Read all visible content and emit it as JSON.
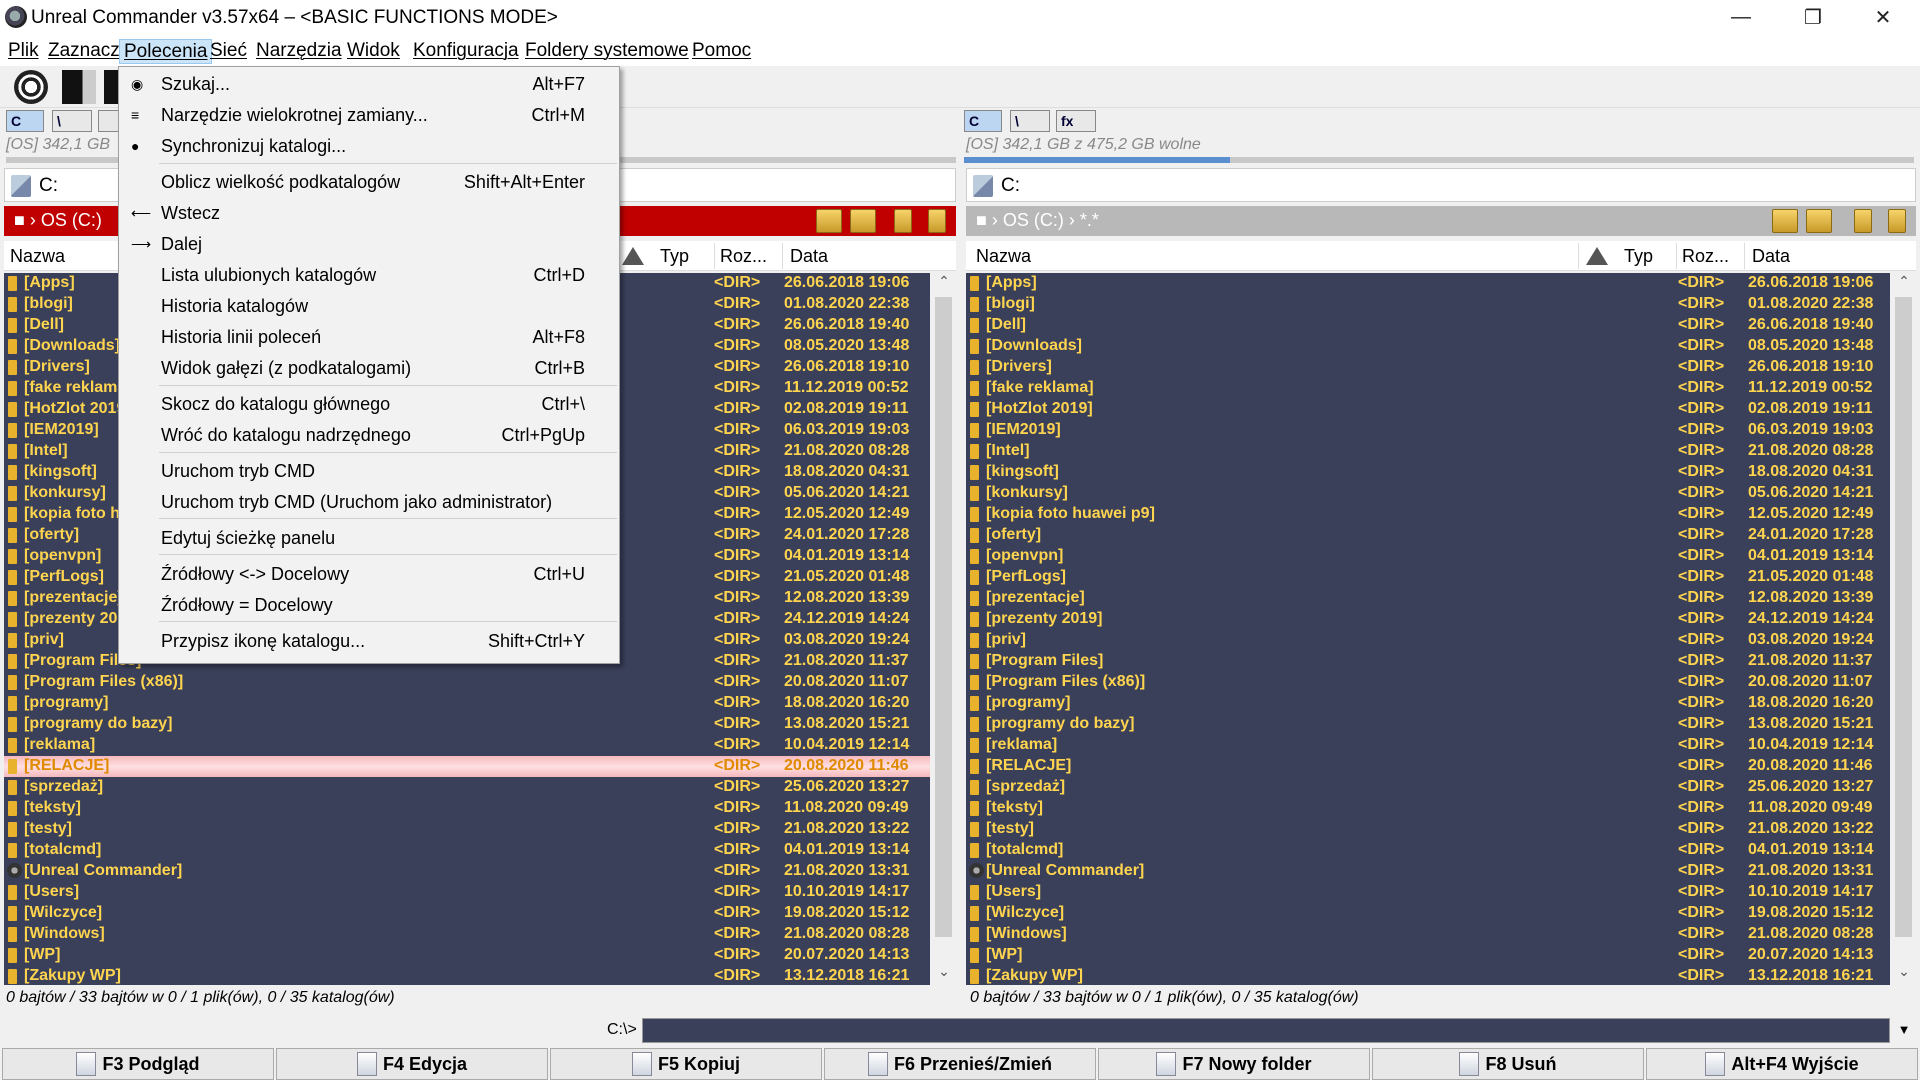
{
  "window": {
    "title": "Unreal Commander v3.57x64 – <BASIC FUNCTIONS MODE>"
  },
  "menubar": [
    {
      "label": "Plik"
    },
    {
      "label": "Zaznacz"
    },
    {
      "label": "Polecenia"
    },
    {
      "label": "Sieć"
    },
    {
      "label": "Narzędzia"
    },
    {
      "label": "Widok"
    },
    {
      "label": "Konfiguracja"
    },
    {
      "label": "Foldery systemowe"
    },
    {
      "label": "Pomoc"
    }
  ],
  "dropdown": [
    {
      "label": "Szukaj...",
      "shortcut": "Alt+F7",
      "icon": "search-icon"
    },
    {
      "label": "Narzędzie wielokrotnej zamiany...",
      "shortcut": "Ctrl+M",
      "icon": "rename-icon"
    },
    {
      "label": "Synchronizuj katalogi...",
      "shortcut": "",
      "icon": "sync-icon"
    },
    {
      "label": "Oblicz wielkość podkatalogów",
      "shortcut": "Shift+Alt+Enter"
    },
    {
      "label": "Wstecz",
      "shortcut": "",
      "icon": "back-arrow-icon"
    },
    {
      "label": "Dalej",
      "shortcut": "",
      "icon": "forward-arrow-icon"
    },
    {
      "label": "Lista ulubionych katalogów",
      "shortcut": "Ctrl+D"
    },
    {
      "label": "Historia katalogów",
      "shortcut": ""
    },
    {
      "label": "Historia linii poleceń",
      "shortcut": "Alt+F8"
    },
    {
      "label": "Widok gałęzi (z podkatalogami)",
      "shortcut": "Ctrl+B"
    },
    {
      "label": "Skocz do katalogu głównego",
      "shortcut": "Ctrl+\\"
    },
    {
      "label": "Wróć do katalogu nadrzędnego",
      "shortcut": "Ctrl+PgUp"
    },
    {
      "label": "Uruchom tryb CMD",
      "shortcut": ""
    },
    {
      "label": "Uruchom tryb CMD (Uruchom jako administrator)",
      "shortcut": ""
    },
    {
      "label": "Edytuj ścieżkę panelu",
      "shortcut": ""
    },
    {
      "label": "Źródłowy <-> Docelowy",
      "shortcut": "Ctrl+U"
    },
    {
      "label": "Źródłowy = Docelowy",
      "shortcut": ""
    },
    {
      "label": "Przypisz ikonę katalogu...",
      "shortcut": "Shift+Ctrl+Y"
    }
  ],
  "left_panel": {
    "drive_info": "[OS]  342,1 GB",
    "path": "C:",
    "breadcrumb": "OS (C:)",
    "status": "0 bajtów / 33 bajtów w 0 / 1 plik(ów), 0 / 35 katalog(ów)"
  },
  "right_panel": {
    "drive_info": "[OS]  342,1 GB z 475,2 GB wolne",
    "path": "C:",
    "breadcrumb": "OS (C:) › *.*",
    "status": "0 bajtów / 33 bajtów w 0 / 1 plik(ów), 0 / 35 katalog(ów)",
    "free_fraction": 0.28
  },
  "drives": {
    "c": "C",
    "net": "\\",
    "fx": "fx"
  },
  "columns": {
    "name": "Nazwa",
    "type": "Typ",
    "size": "Roz...",
    "date": "Data"
  },
  "files": [
    {
      "name": "[Apps]",
      "type": "<DIR>",
      "date": "26.06.2018 19:06"
    },
    {
      "name": "[blogi]",
      "type": "<DIR>",
      "date": "01.08.2020 22:38"
    },
    {
      "name": "[Dell]",
      "type": "<DIR>",
      "date": "26.06.2018 19:40"
    },
    {
      "name": "[Downloads]",
      "type": "<DIR>",
      "date": "08.05.2020 13:48"
    },
    {
      "name": "[Drivers]",
      "type": "<DIR>",
      "date": "26.06.2018 19:10"
    },
    {
      "name": "[fake reklama]",
      "type": "<DIR>",
      "date": "11.12.2019 00:52"
    },
    {
      "name": "[HotZlot 2019]",
      "type": "<DIR>",
      "date": "02.08.2019 19:11"
    },
    {
      "name": "[IEM2019]",
      "type": "<DIR>",
      "date": "06.03.2019 19:03"
    },
    {
      "name": "[Intel]",
      "type": "<DIR>",
      "date": "21.08.2020 08:28"
    },
    {
      "name": "[kingsoft]",
      "type": "<DIR>",
      "date": "18.08.2020 04:31"
    },
    {
      "name": "[konkursy]",
      "type": "<DIR>",
      "date": "05.06.2020 14:21"
    },
    {
      "name": "[kopia foto huawei p9]",
      "type": "<DIR>",
      "date": "12.05.2020 12:49"
    },
    {
      "name": "[oferty]",
      "type": "<DIR>",
      "date": "24.01.2020 17:28"
    },
    {
      "name": "[openvpn]",
      "type": "<DIR>",
      "date": "04.01.2019 13:14"
    },
    {
      "name": "[PerfLogs]",
      "type": "<DIR>",
      "date": "21.05.2020 01:48"
    },
    {
      "name": "[prezentacje]",
      "type": "<DIR>",
      "date": "12.08.2020 13:39"
    },
    {
      "name": "[prezenty 2019]",
      "type": "<DIR>",
      "date": "24.12.2019 14:24"
    },
    {
      "name": "[priv]",
      "type": "<DIR>",
      "date": "03.08.2020 19:24"
    },
    {
      "name": "[Program Files]",
      "type": "<DIR>",
      "date": "21.08.2020 11:37"
    },
    {
      "name": "[Program Files (x86)]",
      "type": "<DIR>",
      "date": "20.08.2020 11:07"
    },
    {
      "name": "[programy]",
      "type": "<DIR>",
      "date": "18.08.2020 16:20"
    },
    {
      "name": "[programy do bazy]",
      "type": "<DIR>",
      "date": "13.08.2020 15:21"
    },
    {
      "name": "[reklama]",
      "type": "<DIR>",
      "date": "10.04.2019 12:14"
    },
    {
      "name": "[RELACJE]",
      "type": "<DIR>",
      "date": "20.08.2020 11:46"
    },
    {
      "name": "[sprzedaż]",
      "type": "<DIR>",
      "date": "25.06.2020 13:27"
    },
    {
      "name": "[teksty]",
      "type": "<DIR>",
      "date": "11.08.2020 09:49"
    },
    {
      "name": "[testy]",
      "type": "<DIR>",
      "date": "21.08.2020 13:22"
    },
    {
      "name": "[totalcmd]",
      "type": "<DIR>",
      "date": "04.01.2019 13:14"
    },
    {
      "name": "[Unreal Commander]",
      "type": "<DIR>",
      "date": "21.08.2020 13:31"
    },
    {
      "name": "[Users]",
      "type": "<DIR>",
      "date": "10.10.2019 14:17"
    },
    {
      "name": "[Wilczyce]",
      "type": "<DIR>",
      "date": "19.08.2020 15:12"
    },
    {
      "name": "[Windows]",
      "type": "<DIR>",
      "date": "21.08.2020 08:28"
    },
    {
      "name": "[WP]",
      "type": "<DIR>",
      "date": "20.07.2020 14:13"
    },
    {
      "name": "[Zakupy WP]",
      "type": "<DIR>",
      "date": "13.12.2018 16:21"
    }
  ],
  "left_hidden_widths_note_free": null,
  "cmdline": {
    "label": "C:\\>"
  },
  "fkeys": [
    {
      "label": "F3 Podgląd"
    },
    {
      "label": "F4 Edycja"
    },
    {
      "label": "F5 Kopiuj"
    },
    {
      "label": "F6 Przenieś/Zmień"
    },
    {
      "label": "F7 Nowy folder"
    },
    {
      "label": "F8 Usuń"
    },
    {
      "label": "Alt+F4 Wyjście"
    }
  ],
  "colors": {
    "active_header": "#c00000",
    "list_bg": "#3a3f5a",
    "file_text": "#ffd54f",
    "menu_highlight": "#cce4f7"
  }
}
